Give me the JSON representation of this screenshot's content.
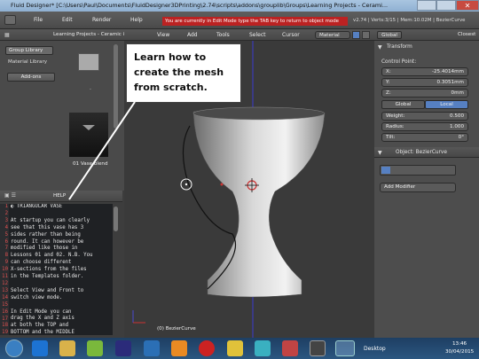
{
  "window": {
    "title": "Fluid Designer* [C:\\Users\\Paul\\Documents\\FluidDesigner3DPrinting\\2.74\\scripts\\addons\\grouplib\\Groups\\Learning Projects - Cerami...",
    "close": "✕"
  },
  "menubar": {
    "items": [
      "File",
      "Edit",
      "Render",
      "Help"
    ],
    "warning": "You are currently in Edit Mode type the TAB key to return to object mode",
    "info": "v2.74 | Verts:3/15 | Mem:10.02M | BezierCurve"
  },
  "library": {
    "path": "Learning Projects - Ceramic & Porce",
    "tabs": [
      "Group Library",
      "Material Library"
    ],
    "addons_label": "Add-ons",
    "items": [
      {
        "name": "."
      },
      {
        "name": "01 Vase.blend"
      }
    ]
  },
  "viewport": {
    "menus": [
      "View",
      "Add",
      "Tools",
      "Select",
      "Cursor"
    ],
    "material": "Material",
    "orientation": "Global",
    "closest": "Closest",
    "object_label": "(0) BezierCurve"
  },
  "help": {
    "label": "HELP"
  },
  "text_editor": {
    "lines": [
      {
        "n": "1",
        "t": "◐ TRIANGULAR VASE"
      },
      {
        "n": "2",
        "t": ""
      },
      {
        "n": "3",
        "t": "At startup you can clearly"
      },
      {
        "n": "4",
        "t": "see that this vase has 3"
      },
      {
        "n": "5",
        "t": "sides rather than being"
      },
      {
        "n": "6",
        "t": "round. It can however be"
      },
      {
        "n": "7",
        "t": "modified like those in"
      },
      {
        "n": "8",
        "t": "Lessons 01 and 02. N.B. You"
      },
      {
        "n": "9",
        "t": "can choose different"
      },
      {
        "n": "10",
        "t": "X-sections from the files"
      },
      {
        "n": "11",
        "t": "in the Templates folder."
      },
      {
        "n": "12",
        "t": ""
      },
      {
        "n": "13",
        "t": "Select View and Front to"
      },
      {
        "n": "14",
        "t": "switch view mode."
      },
      {
        "n": "15",
        "t": ""
      },
      {
        "n": "16",
        "t": "In Edit Mode you can"
      },
      {
        "n": "17",
        "t": "drag the X and Z axis"
      },
      {
        "n": "18",
        "t": "at both the TOP and"
      },
      {
        "n": "19",
        "t": "BOTTOM and the MIDDLE"
      }
    ]
  },
  "callout": {
    "line1": "Learn how to",
    "line2": "create the mesh",
    "line3": "from scratch."
  },
  "transform": {
    "title": "Transform",
    "control_point_label": "Control Point:",
    "x": {
      "label": "X:",
      "value": "-25.4014mm"
    },
    "y": {
      "label": "Y:",
      "value": "0.3051mm"
    },
    "z": {
      "label": "Z:",
      "value": "0mm"
    },
    "global": "Global",
    "local": "Local",
    "weight": {
      "label": "Weight:",
      "value": "0.500"
    },
    "radius": {
      "label": "Radius:",
      "value": "1.000"
    },
    "tilt": {
      "label": "Tilt:",
      "value": "0°"
    }
  },
  "object_panel": {
    "title": "Object: BezierCurve",
    "modifier": "Add Modifier"
  },
  "taskbar": {
    "desktop": "Desktop",
    "time": "13:46",
    "date": "30/04/2015"
  },
  "colors": {
    "warning": "#bb2222",
    "accent": "#5680c2",
    "taskbar": "#1e3f63"
  }
}
